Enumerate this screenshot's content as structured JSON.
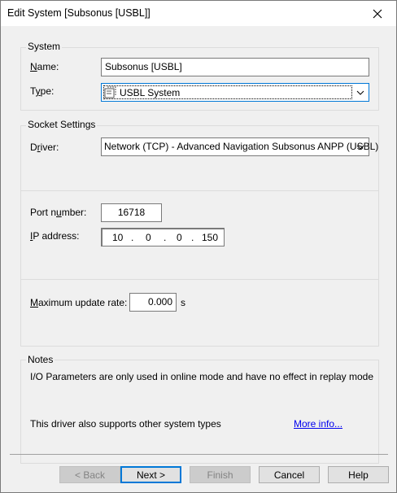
{
  "window": {
    "title": "Edit System [Subsonus [USBL]]"
  },
  "system_group": {
    "label": "System",
    "name_label": "Name:",
    "name_value": "Subsonus [USBL]",
    "type_label": "Type:",
    "type_value": "USBL System",
    "type_icon": "usbl-system-icon"
  },
  "socket_group": {
    "label": "Socket Settings",
    "driver_label": "Driver:",
    "driver_value": "Network (TCP) - Advanced Navigation Subsonus ANPP (USBL)",
    "port_label": "Port number:",
    "port_value": "16718",
    "ip_label": "IP address:",
    "ip_octets": [
      "10",
      "0",
      "0",
      "150"
    ],
    "ip_dot": ".",
    "rate_label": "Maximum update rate:",
    "rate_value": "0.000",
    "rate_unit": "s"
  },
  "notes_group": {
    "label": "Notes",
    "note_text": "I/O Parameters are only used in online mode and have no effect in replay mode",
    "support_text": "This driver also supports other system types",
    "more_info_link": "More info..."
  },
  "buttons": {
    "back": "< Back",
    "next": "Next >",
    "finish": "Finish",
    "cancel": "Cancel",
    "help": "Help"
  }
}
